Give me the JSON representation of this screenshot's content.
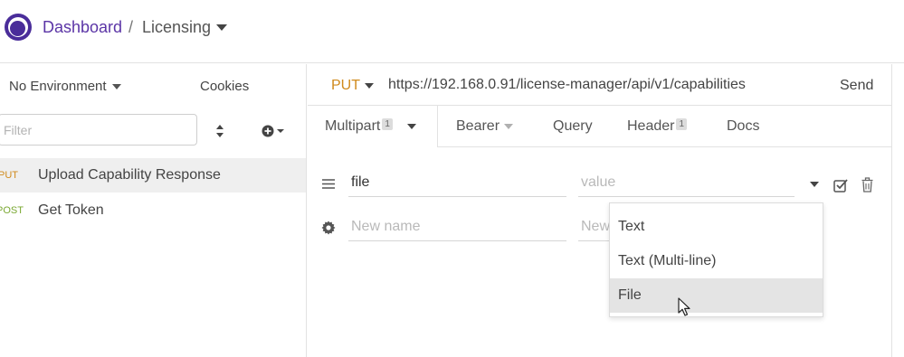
{
  "header": {
    "dashboard_label": "Dashboard",
    "separator": "/",
    "workspace_label": "Licensing",
    "icons": [
      "logo",
      "chevron-down-icon"
    ]
  },
  "sidebar": {
    "environment_label": "No Environment",
    "cookies_label": "Cookies",
    "filter_placeholder": "Filter",
    "requests": [
      {
        "method": "PUT",
        "name": "Upload Capability Response",
        "active": true,
        "method_color": "#d08a1c"
      },
      {
        "method": "POST",
        "name": "Get Token",
        "active": false,
        "method_color": "#7aa832"
      }
    ]
  },
  "request": {
    "method": "PUT",
    "method_color": "#d08a1c",
    "url": "https://192.168.0.91/license-manager/api/v1/capabilities",
    "send_label": "Send"
  },
  "tabs": [
    {
      "label": "Multipart",
      "count": "1",
      "active": true
    },
    {
      "label": "Bearer",
      "active": false
    },
    {
      "label": "Query",
      "active": false
    },
    {
      "label": "Header",
      "count": "1",
      "active": false
    },
    {
      "label": "Docs",
      "active": false
    }
  ],
  "params": {
    "row1": {
      "name": "file",
      "value_placeholder": "value"
    },
    "row2": {
      "name_placeholder": "New name",
      "value_placeholder": "New"
    }
  },
  "type_dropdown": {
    "options": [
      "Text",
      "Text (Multi-line)",
      "File"
    ],
    "hovered": "File"
  },
  "colors": {
    "brand": "#5b35a6",
    "put": "#d08a1c",
    "post": "#7aa832",
    "hover_bg": "#e4e4e4"
  }
}
